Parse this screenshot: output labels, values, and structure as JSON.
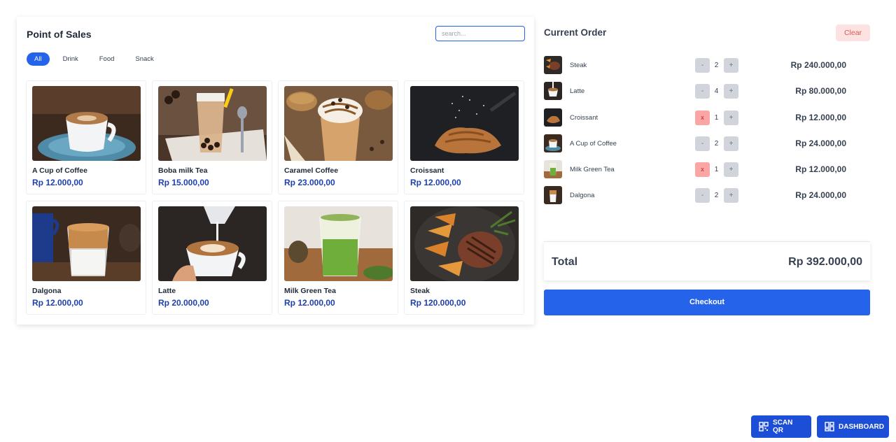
{
  "pos": {
    "title": "Point of Sales",
    "search_placeholder": "search...",
    "categories": [
      "All",
      "Drink",
      "Food",
      "Snack"
    ],
    "products": [
      {
        "name": "A Cup of Coffee",
        "price": "Rp 12.000,00",
        "image": "coffee-cup-image"
      },
      {
        "name": "Boba milk Tea",
        "price": "Rp 15.000,00",
        "image": "boba-tea-image"
      },
      {
        "name": "Caramel Coffee",
        "price": "Rp 23.000,00",
        "image": "caramel-coffee-image"
      },
      {
        "name": "Croissant",
        "price": "Rp 12.000,00",
        "image": "croissant-image"
      },
      {
        "name": "Dalgona",
        "price": "Rp 12.000,00",
        "image": "dalgona-image"
      },
      {
        "name": "Latte",
        "price": "Rp 20.000,00",
        "image": "latte-image"
      },
      {
        "name": "Milk Green Tea",
        "price": "Rp 12.000,00",
        "image": "green-tea-image"
      },
      {
        "name": "Steak",
        "price": "Rp 120.000,00",
        "image": "steak-image"
      }
    ]
  },
  "order": {
    "title": "Current Order",
    "clear_label": "Clear",
    "items": [
      {
        "name": "Steak",
        "qty": "2",
        "price": "Rp 240.000,00",
        "left_btn": "-",
        "plus": "+"
      },
      {
        "name": "Latte",
        "qty": "4",
        "price": "Rp 80.000,00",
        "left_btn": "-",
        "plus": "+"
      },
      {
        "name": "Croissant",
        "qty": "1",
        "price": "Rp 12.000,00",
        "left_btn": "x",
        "plus": "+"
      },
      {
        "name": "A Cup of Coffee",
        "qty": "2",
        "price": "Rp 24.000,00",
        "left_btn": "-",
        "plus": "+"
      },
      {
        "name": "Milk Green Tea",
        "qty": "1",
        "price": "Rp 12.000,00",
        "left_btn": "x",
        "plus": "+"
      },
      {
        "name": "Dalgona",
        "qty": "2",
        "price": "Rp 24.000,00",
        "left_btn": "-",
        "plus": "+"
      }
    ],
    "total_label": "Total",
    "total_value": "Rp 392.000,00",
    "checkout_label": "Checkout"
  },
  "actions": {
    "scan_label": "SCAN QR",
    "dashboard_label": "DASHBOARD"
  },
  "colors": {
    "primary": "#2563eb",
    "price_text": "#1e40af",
    "clear_bg": "#fde2e2",
    "remove_bg": "#fca5a5"
  }
}
